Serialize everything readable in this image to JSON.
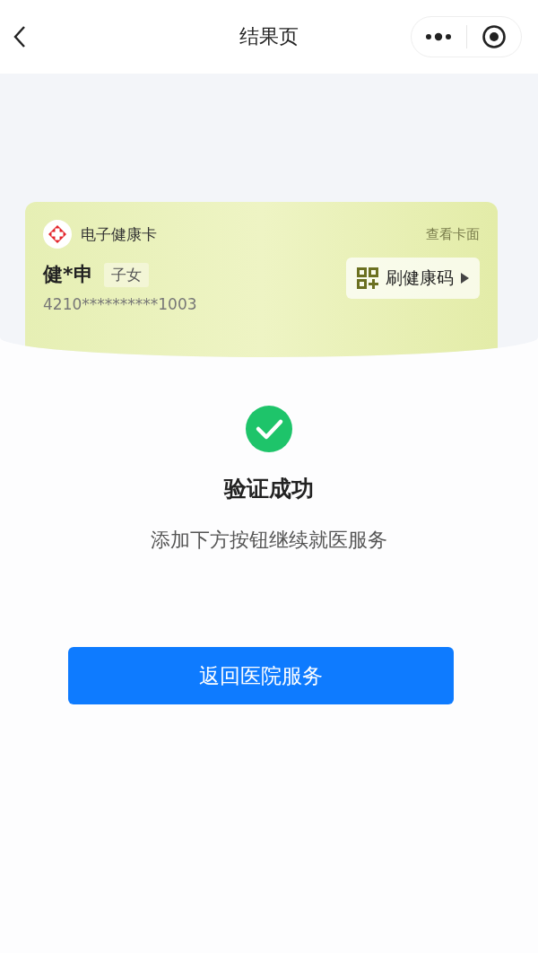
{
  "nav": {
    "title": "结果页"
  },
  "card": {
    "title": "电子健康卡",
    "view_link": "查看卡面",
    "name": "健*申",
    "relation": "子女",
    "id_number": "4210**********1003",
    "code_button": "刷健康码"
  },
  "result": {
    "title": "验证成功",
    "message": "添加下方按钮继续就医服务",
    "button": "返回医院服务"
  }
}
